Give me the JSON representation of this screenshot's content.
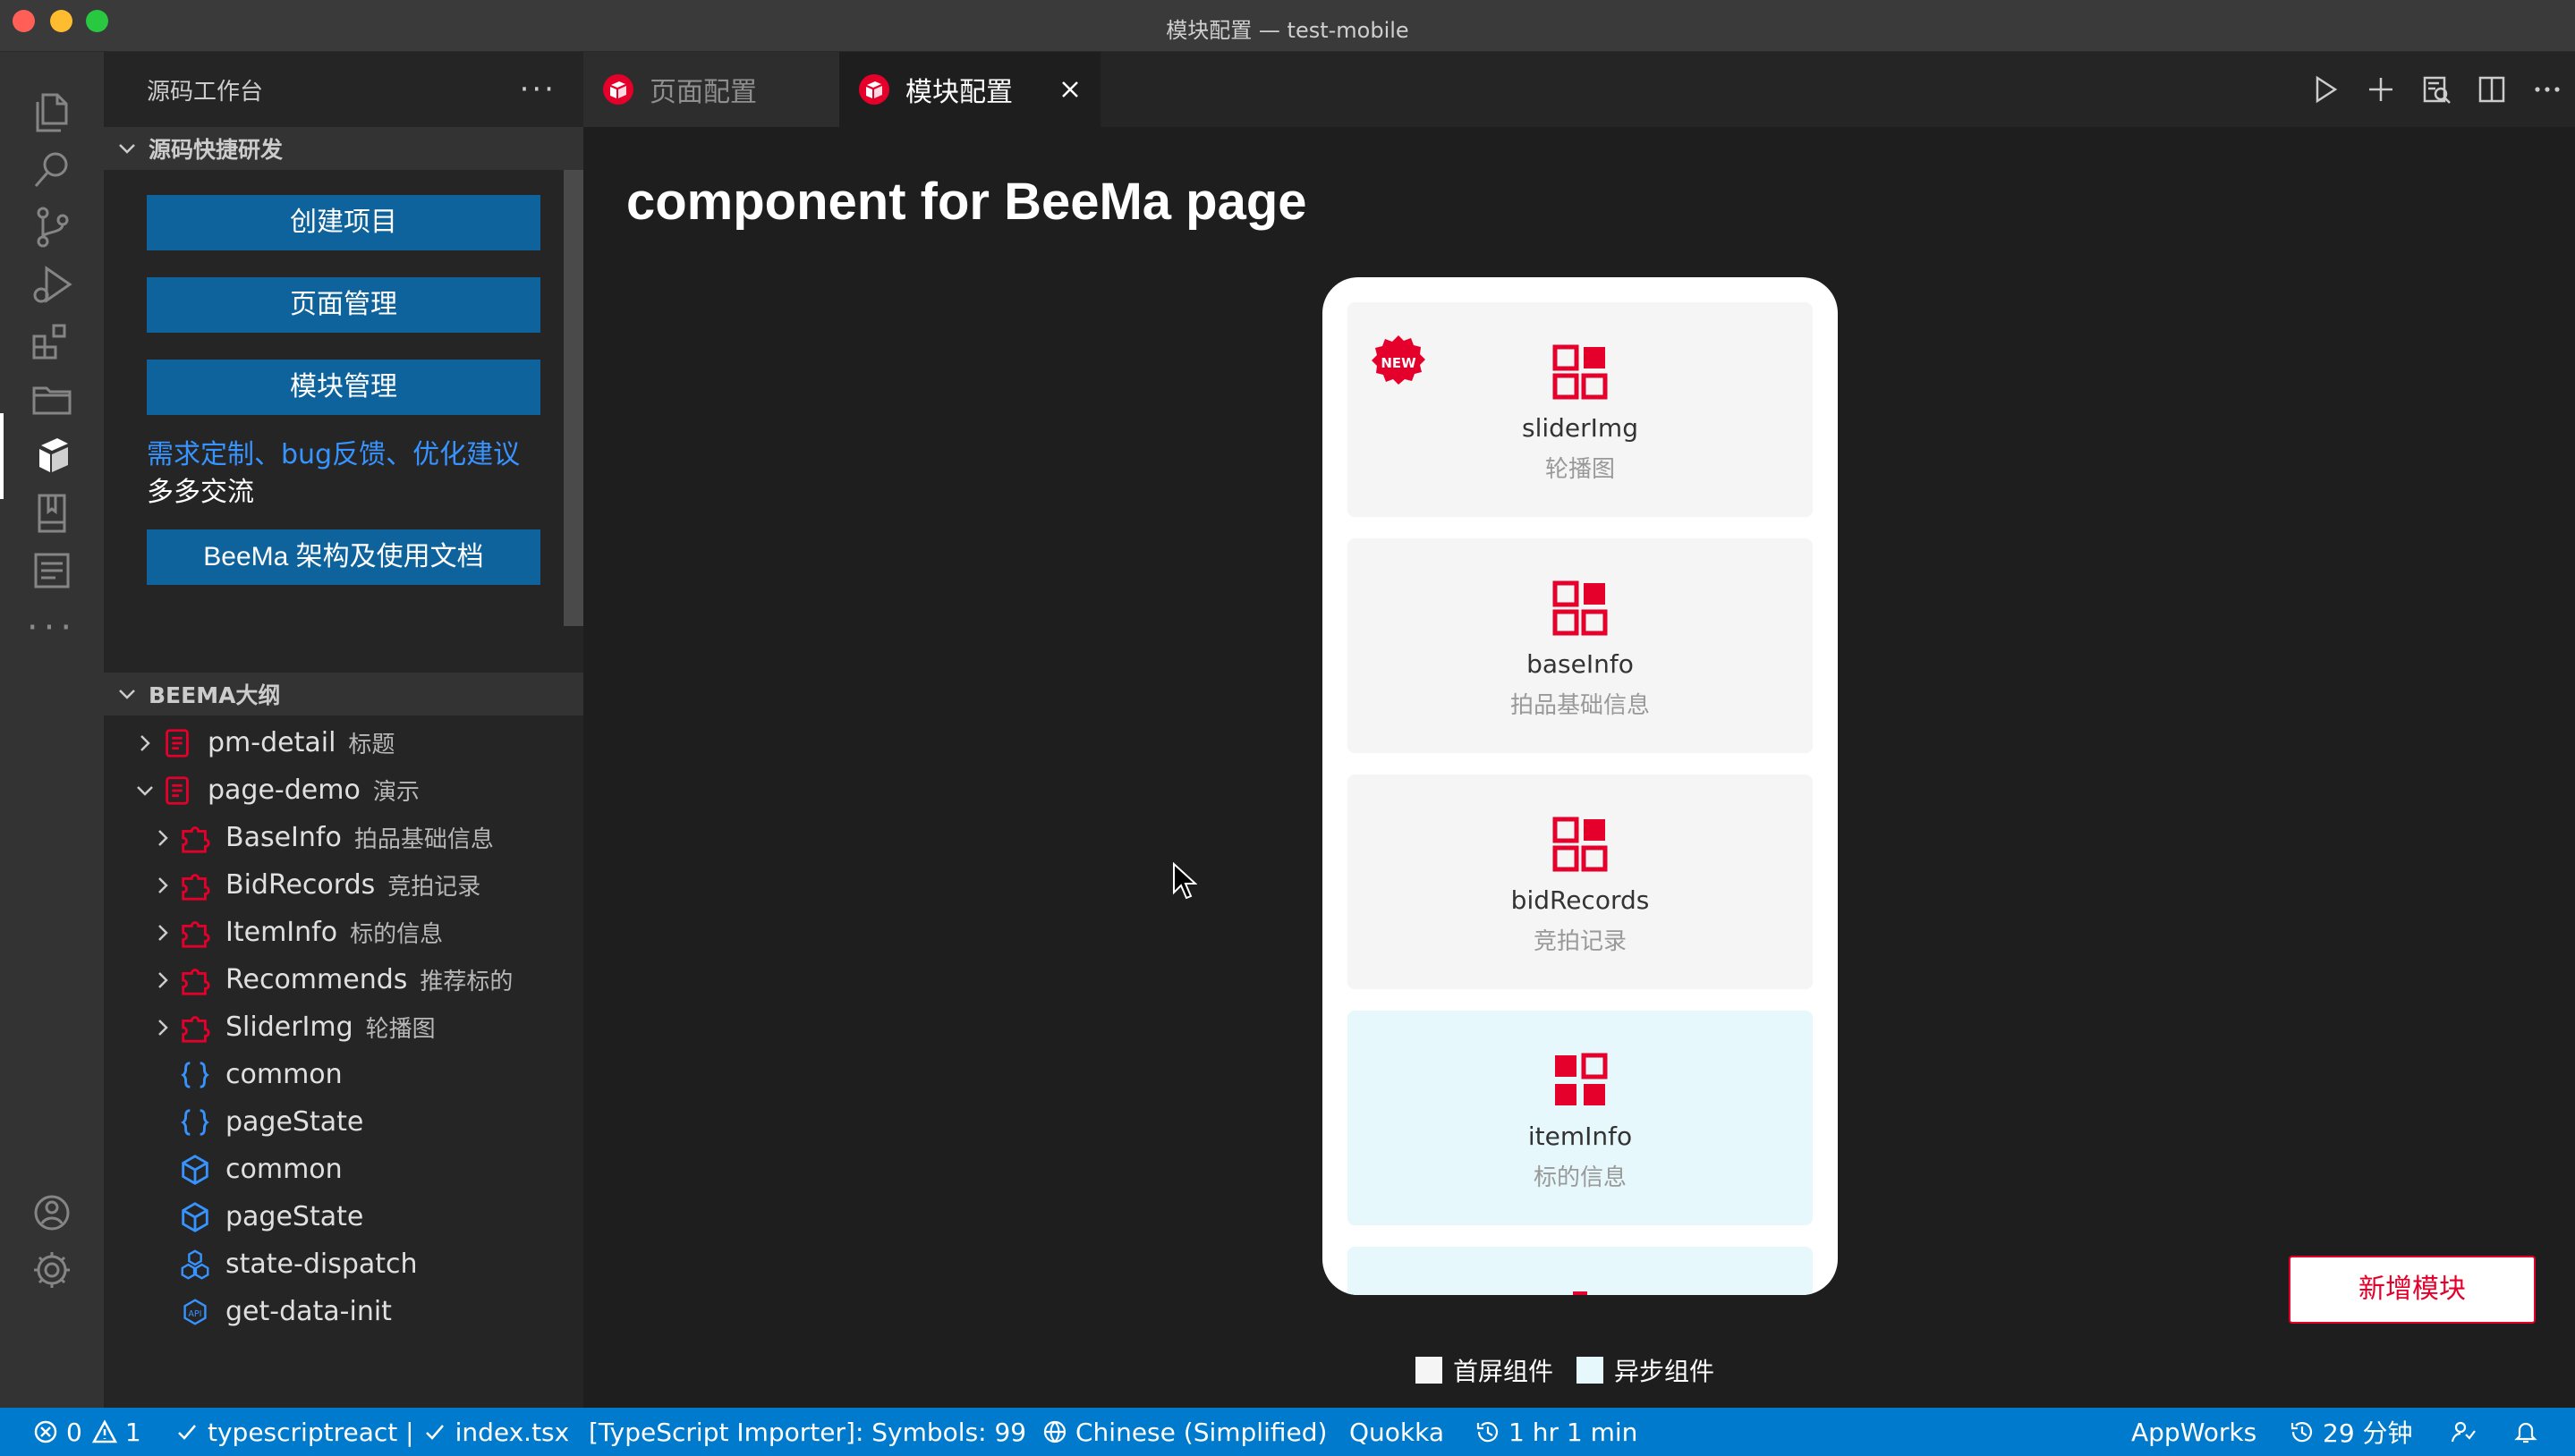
{
  "window": {
    "title": "模块配置 — test-mobile"
  },
  "sidebar": {
    "title": "源码工作台",
    "more": "···",
    "quick_section": {
      "label": "源码快捷研发",
      "buttons": [
        "创建项目",
        "页面管理",
        "模块管理"
      ],
      "feedback_link": "需求定制、bug反馈、优化建议",
      "feedback_text": "多多交流",
      "docs_button": "BeeMa 架构及使用文档"
    },
    "outline_section": {
      "label": "BEEMA大纲",
      "items": [
        {
          "name": "pm-detail",
          "desc": "标题"
        },
        {
          "name": "page-demo",
          "desc": "演示"
        },
        {
          "name": "BaseInfo",
          "desc": "拍品基础信息"
        },
        {
          "name": "BidRecords",
          "desc": "竞拍记录"
        },
        {
          "name": "ItemInfo",
          "desc": "标的信息"
        },
        {
          "name": "Recommends",
          "desc": "推荐标的"
        },
        {
          "name": "SliderImg",
          "desc": "轮播图"
        },
        {
          "name": "common",
          "desc": ""
        },
        {
          "name": "pageState",
          "desc": ""
        },
        {
          "name": "common",
          "desc": ""
        },
        {
          "name": "pageState",
          "desc": ""
        },
        {
          "name": "state-dispatch",
          "desc": ""
        },
        {
          "name": "get-data-init",
          "desc": ""
        }
      ]
    }
  },
  "tabs": [
    {
      "label": "页面配置",
      "active": false
    },
    {
      "label": "模块配置",
      "active": true
    }
  ],
  "editor": {
    "title": "component for BeeMa page",
    "badge": "NEW",
    "cards": [
      {
        "name": "sliderImg",
        "desc": "轮播图",
        "type": "first-screen"
      },
      {
        "name": "baseInfo",
        "desc": "拍品基础信息",
        "type": "first-screen"
      },
      {
        "name": "bidRecords",
        "desc": "竞拍记录",
        "type": "first-screen"
      },
      {
        "name": "itemInfo",
        "desc": "标的信息",
        "type": "async"
      }
    ],
    "legend": {
      "first_screen": "首屏组件",
      "async": "异步组件"
    },
    "add_button": "新增模块"
  },
  "colors": {
    "accent_red": "#e4002b",
    "button_blue": "#0e639c",
    "status_blue": "#007acc",
    "async_bg": "#e6f8fc"
  },
  "statusbar": {
    "errors": "0",
    "warnings": "1",
    "language": "typescriptreact |",
    "file": "index.tsx",
    "importer": "[TypeScript Importer]: Symbols: 99",
    "locale": "Chinese (Simplified)",
    "quokka": "Quokka",
    "time": "1 hr 1 min",
    "appworks": "AppWorks",
    "minutes": "29 分钟"
  }
}
